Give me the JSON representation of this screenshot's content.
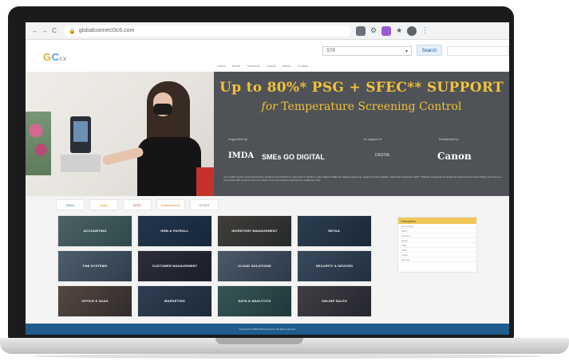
{
  "browser": {
    "url": "globalconnect3c6.com",
    "nav": {
      "back": "←",
      "forward": "→",
      "reload": "C"
    }
  },
  "site": {
    "logo": {
      "g": "G",
      "c": "C",
      "small": "cx"
    },
    "search": {
      "value": "S78",
      "button": "Search"
    },
    "nav_items": [
      "Home",
      "About",
      "Solutions",
      "Grants",
      "Media",
      "Contact"
    ]
  },
  "banner": {
    "headline": "Up to 80%* PSG + SFEC** SUPPORT",
    "sub_for": "for",
    "sub_rest": "Temperature Screening Control",
    "supported_by": "Supported by",
    "as_part_of": "In support of",
    "distributed_by": "Distributed by",
    "logo_imda": "IMDA",
    "logo_smes": "SMEs GO DIGITAL",
    "logo_sec": "DIGITAL",
    "logo_canon": "Canon",
    "fine_print": "*Up to 80% support under Productivity Solutions Grant (PSG) for approved IT solutions under IMDA's SMEs Go Digital programme, subject to PSG eligibility. Valid till 31 December 2020. **Eligible companies for Enterprise Development Grant (SFEC) will receive a one-off $10,000 credit to cover up to 90% of the out-of-pocket expenses for qualifying costs."
  },
  "partners": [
    "IMDA",
    "SMEs",
    "SFEC",
    "EnterpriseSG",
    "CITIES"
  ],
  "tiles": [
    {
      "label": "ACCOUNTING"
    },
    {
      "label": "HRM & PAYROLL"
    },
    {
      "label": "INVENTORY MANAGEMENT"
    },
    {
      "label": "RETAIL"
    },
    {
      "label": "F&B SYSTEMS"
    },
    {
      "label": "CUSTOMER MANAGEMENT"
    },
    {
      "label": "CLOUD SOLUTIONS"
    },
    {
      "label": "SECURITY & DEVICES"
    },
    {
      "label": "OFFICE & SAAS"
    },
    {
      "label": "MARKETING"
    },
    {
      "label": "DATA & ANALYTICS"
    },
    {
      "label": "ONLINE SALES"
    }
  ],
  "sidebar": {
    "title": "Categories",
    "items": [
      "Accounting",
      "HRM",
      "Inventory",
      "Retail",
      "F&B",
      "CRM",
      "Cloud",
      "Security"
    ]
  },
  "footer": {
    "text": "Copyright © 2020 Global Connect. All rights reserved."
  },
  "colors": {
    "banner_bg": "#4f5256",
    "accent_yellow": "#f2c23a",
    "footer_bg": "#1f5b8c"
  }
}
